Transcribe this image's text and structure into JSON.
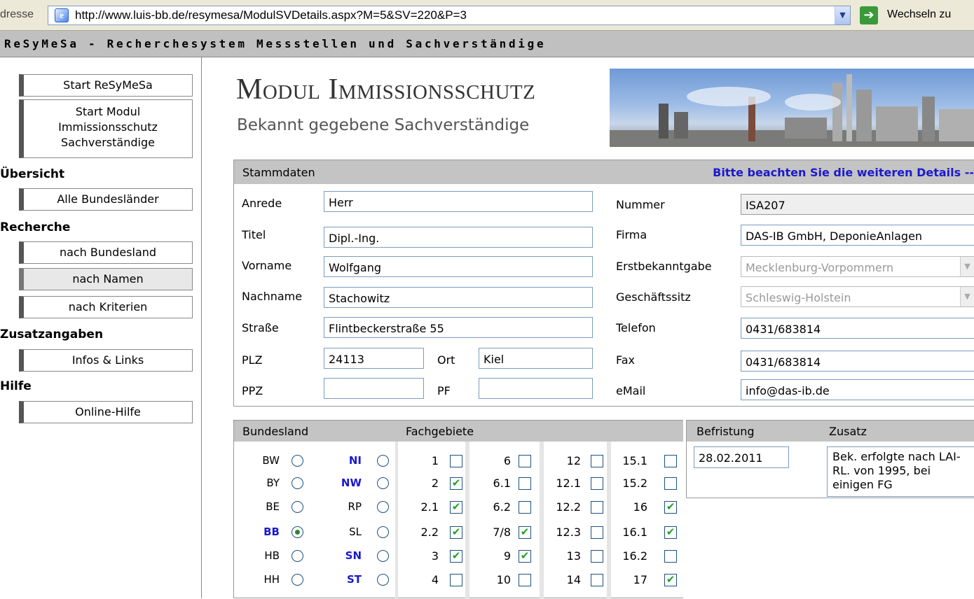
{
  "browser": {
    "address_label": "dresse",
    "url": "http://www.luis-bb.de/resymesa/ModulSVDetails.aspx?M=5&SV=220&P=3",
    "go_label": "Wechseln zu"
  },
  "app": {
    "title": "ReSyMeSa - Recherchesystem Messstellen und Sachverständige"
  },
  "nav": {
    "start": "Start ReSyMeSa",
    "start_modul_l1": "Start Modul",
    "start_modul_l2": "Immissionsschutz",
    "start_modul_l3": "Sachverständige",
    "h_uebersicht": "Übersicht",
    "alle": "Alle Bundesländer",
    "h_recherche": "Recherche",
    "bundesland": "nach Bundesland",
    "namen": "nach Namen",
    "kriterien": "nach Kriterien",
    "h_zusatz": "Zusatzangaben",
    "infos": "Infos & Links",
    "h_hilfe": "Hilfe",
    "online": "Online-Hilfe"
  },
  "header": {
    "title": "Modul Immissionsschutz",
    "subtitle": "Bekannt gegebene Sachverständige"
  },
  "stamm": {
    "heading": "Stammdaten",
    "hint": "Bitte beachten Sie die weiteren Details --",
    "labels": {
      "anrede": "Anrede",
      "titel": "Titel",
      "vorname": "Vorname",
      "nachname": "Nachname",
      "strasse": "Straße",
      "plz": "PLZ",
      "ort": "Ort",
      "ppz": "PPZ",
      "pf": "PF",
      "nummer": "Nummer",
      "firma": "Firma",
      "erst": "Erstbekanntgabe",
      "sitz": "Geschäftssitz",
      "telefon": "Telefon",
      "fax": "Fax",
      "email": "eMail"
    },
    "values": {
      "anrede": "Herr",
      "titel": "Dipl.-Ing.",
      "vorname": "Wolfgang",
      "nachname": "Stachowitz",
      "strasse": "Flintbeckerstraße 55",
      "plz": "24113",
      "ort": "Kiel",
      "ppz": "",
      "pf": "",
      "nummer": "ISA207",
      "firma": "DAS-IB GmbH, DeponieAnlagen",
      "erst": "Mecklenburg-Vorpommern",
      "sitz": "Schleswig-Holstein",
      "telefon": "0431/683814",
      "fax": "0431/683814",
      "email": "info@das-ib.de"
    }
  },
  "bundesland": {
    "heading": "Bundesland",
    "left": [
      {
        "code": "BW",
        "blue": false,
        "selected": false
      },
      {
        "code": "BY",
        "blue": false,
        "selected": false
      },
      {
        "code": "BE",
        "blue": false,
        "selected": false
      },
      {
        "code": "BB",
        "blue": true,
        "selected": true
      },
      {
        "code": "HB",
        "blue": false,
        "selected": false
      },
      {
        "code": "HH",
        "blue": false,
        "selected": false
      }
    ],
    "right": [
      {
        "code": "NI",
        "blue": true,
        "selected": false
      },
      {
        "code": "NW",
        "blue": true,
        "selected": false
      },
      {
        "code": "RP",
        "blue": false,
        "selected": false
      },
      {
        "code": "SL",
        "blue": false,
        "selected": false
      },
      {
        "code": "SN",
        "blue": true,
        "selected": false
      },
      {
        "code": "ST",
        "blue": true,
        "selected": false
      }
    ]
  },
  "fachgebiete": {
    "heading": "Fachgebiete",
    "columns": [
      [
        {
          "n": "1",
          "c": false
        },
        {
          "n": "2",
          "c": true
        },
        {
          "n": "2.1",
          "c": true
        },
        {
          "n": "2.2",
          "c": true
        },
        {
          "n": "3",
          "c": true
        },
        {
          "n": "4",
          "c": false
        }
      ],
      [
        {
          "n": "6",
          "c": false
        },
        {
          "n": "6.1",
          "c": false
        },
        {
          "n": "6.2",
          "c": false
        },
        {
          "n": "7/8",
          "c": true
        },
        {
          "n": "9",
          "c": true
        },
        {
          "n": "10",
          "c": false
        }
      ],
      [
        {
          "n": "12",
          "c": false
        },
        {
          "n": "12.1",
          "c": false
        },
        {
          "n": "12.2",
          "c": false
        },
        {
          "n": "12.3",
          "c": false
        },
        {
          "n": "13",
          "c": false
        },
        {
          "n": "14",
          "c": false
        }
      ],
      [
        {
          "n": "15.1",
          "c": false
        },
        {
          "n": "15.2",
          "c": false
        },
        {
          "n": "16",
          "c": true
        },
        {
          "n": "16.1",
          "c": true
        },
        {
          "n": "16.2",
          "c": false
        },
        {
          "n": "17",
          "c": true
        }
      ]
    ]
  },
  "befristung": {
    "heading": "Befristung",
    "value": "28.02.2011"
  },
  "zusatz": {
    "heading": "Zusatz",
    "text": "Bek. erfolgte nach LAI-RL. von 1995, bei einigen FG"
  },
  "colors": {
    "accent_blue": "#1a1acc",
    "check_green": "#22a022",
    "panel_gray": "#c4c4c4"
  }
}
